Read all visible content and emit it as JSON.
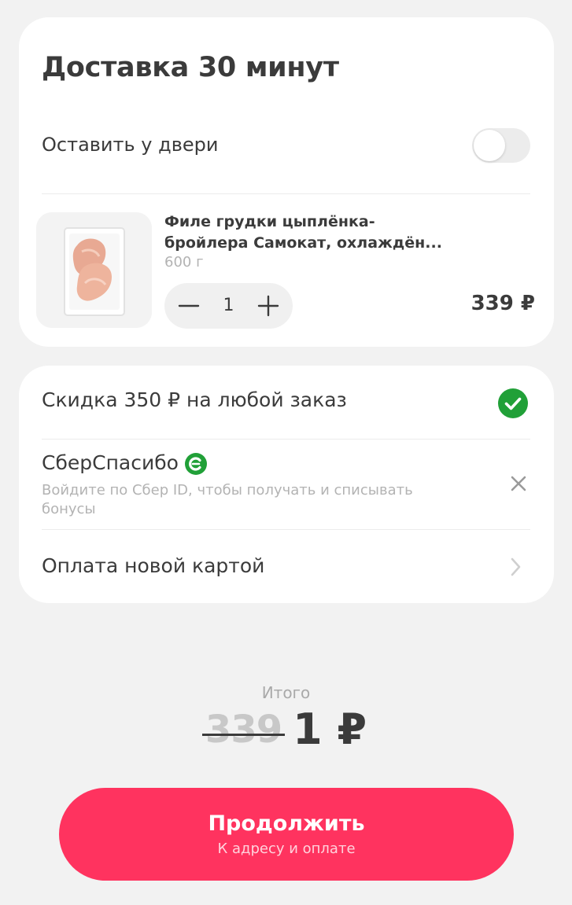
{
  "delivery": {
    "title": "Доставка 30 минут",
    "leave_at_door_label": "Оставить у двери",
    "leave_at_door_enabled": false
  },
  "product": {
    "name": "Филе грудки цыплёнка-бройлера Самокат, охлаждён...",
    "weight": "600 г",
    "quantity": "1",
    "price": "339 ₽",
    "image_icon": "chicken-fillet-photo"
  },
  "options": {
    "discount_label": "Скидка 350 ₽ на любой заказ",
    "discount_applied": true,
    "sber_title": "СберСпасибо",
    "sber_desc": "Войдите по Сбер ID, чтобы получать и списывать бонусы",
    "payment_label": "Оплата новой картой"
  },
  "total": {
    "label": "Итого",
    "old_price": "339",
    "new_price": "1 ₽"
  },
  "continue_button": {
    "label": "Продолжить",
    "sublabel": "К адресу и оплате"
  },
  "colors": {
    "accent": "#ff335f",
    "check_green": "#21a038",
    "background": "#f2f2f2"
  }
}
